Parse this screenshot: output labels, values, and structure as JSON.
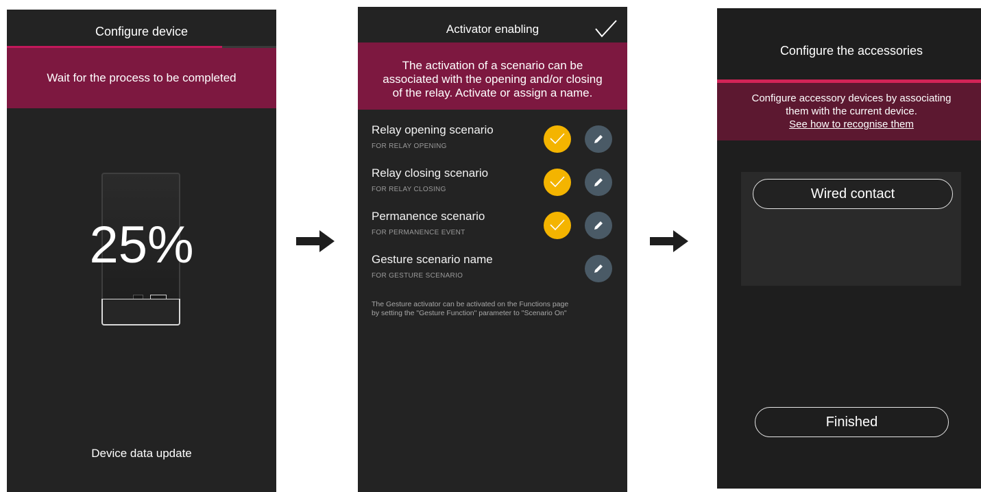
{
  "screen1": {
    "title": "Configure device",
    "banner": "Wait for the process to be completed",
    "progress_fraction": 0.8,
    "percent": "25%",
    "footer": "Device data update"
  },
  "screen2": {
    "title": "Activator enabling",
    "banner_lines": [
      "The activation of a scenario can be",
      "associated with the opening and/or closing",
      "of the relay. Activate or assign a name."
    ],
    "rows": [
      {
        "label": "Relay opening scenario",
        "sub": "FOR RELAY OPENING",
        "enabled": true
      },
      {
        "label": "Relay closing scenario",
        "sub": "FOR RELAY CLOSING",
        "enabled": true
      },
      {
        "label": "Permanence scenario",
        "sub": "FOR PERMANENCE EVENT",
        "enabled": true
      },
      {
        "label": "Gesture scenario name",
        "sub": "FOR GESTURE SCENARIO",
        "enabled": false
      }
    ],
    "note_lines": [
      "The Gesture activator can be activated on the Functions page",
      "by setting the \"Gesture Function\" parameter to \"Scenario On\""
    ],
    "colors": {
      "toggle": "#f4b400",
      "edit": "#4a5a66",
      "banner": "#7d1840"
    }
  },
  "screen3": {
    "title": "Configure the accessories",
    "banner_lines": [
      "Configure accessory devices by associating",
      "them with the current device."
    ],
    "banner_link": "See how to recognise them",
    "wired_button": "Wired contact",
    "finished_button": "Finished",
    "colors": {
      "accent": "#d22457",
      "banner": "#5c1830"
    }
  }
}
